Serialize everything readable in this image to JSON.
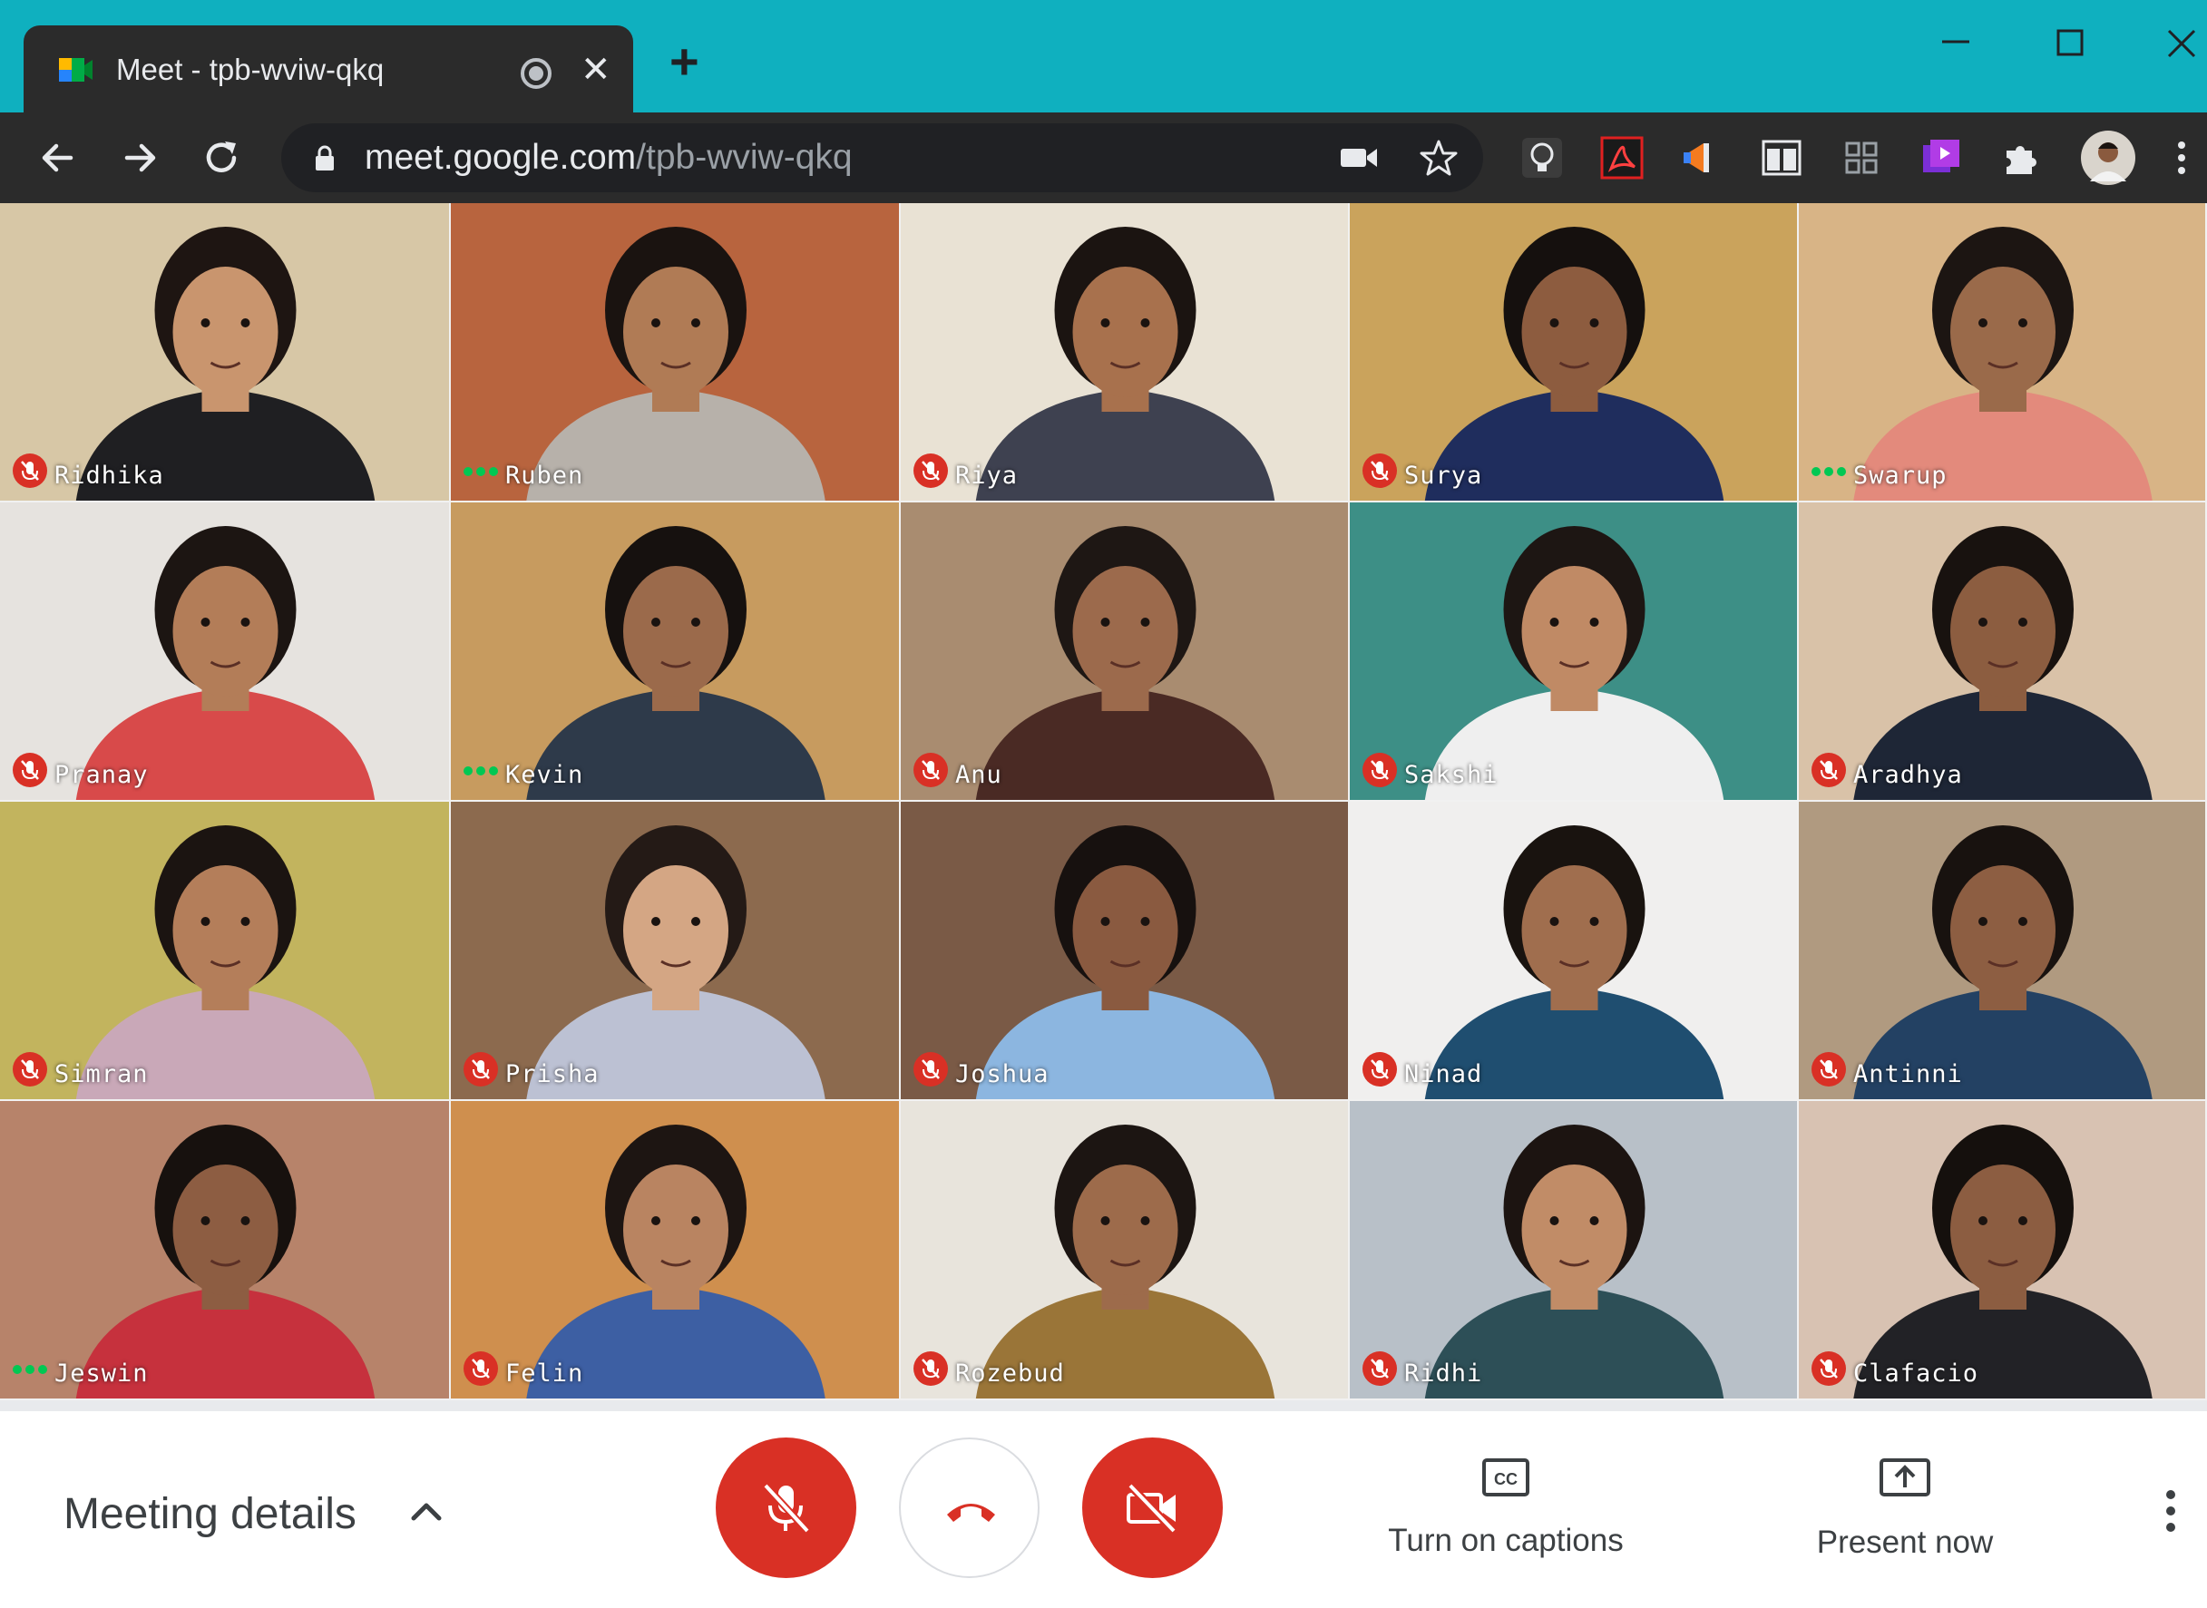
{
  "browser": {
    "tab_title": "Meet - tpb-wviw-qkq",
    "new_tab": "+",
    "close_tab": "✕",
    "url_host": "meet.google.com",
    "url_path": "/tpb-wviw-qkq",
    "colors": {
      "frame": "#0fb0bf",
      "toolbar": "#2b2b2b",
      "omnibox": "#202124"
    },
    "extensions": [
      "lightbulb-icon",
      "acrobat-icon",
      "megaphone-icon",
      "columns-icon",
      "grid-icon",
      "video-ext-icon",
      "puzzle-icon",
      "profile-avatar",
      "menu-dots-icon"
    ]
  },
  "participants": [
    {
      "name": "Ridhika",
      "status": "muted",
      "bg": "#d7c7a6",
      "skin": "#c9956e",
      "hair": "#1e1512",
      "shirt": "#1f1f22"
    },
    {
      "name": "Ruben",
      "status": "speaking",
      "bg": "#b8643e",
      "skin": "#b07b55",
      "hair": "#1a1310",
      "shirt": "#b7b1aa"
    },
    {
      "name": "Riya",
      "status": "muted",
      "bg": "#e9e2d4",
      "skin": "#a8714d",
      "hair": "#1b1411",
      "shirt": "#3e4150"
    },
    {
      "name": "Surya",
      "status": "muted",
      "bg": "#caa35c",
      "skin": "#8d5c3f",
      "hair": "#15100e",
      "shirt": "#1f2d5d"
    },
    {
      "name": "Swarup",
      "status": "speaking",
      "bg": "#d8b486",
      "skin": "#9a6a4a",
      "hair": "#1c1512",
      "shirt": "#e38a7c"
    },
    {
      "name": "Pranay",
      "status": "muted",
      "bg": "#e6e3df",
      "skin": "#b37d58",
      "hair": "#1c1512",
      "shirt": "#d84a4a"
    },
    {
      "name": "Kevin",
      "status": "speaking",
      "bg": "#c79b5f",
      "skin": "#9b6a4b",
      "hair": "#16110f",
      "shirt": "#2e3a4a"
    },
    {
      "name": "Anu",
      "status": "muted",
      "bg": "#a98c70",
      "skin": "#9c6a4c",
      "hair": "#1e1714",
      "shirt": "#4a2a24"
    },
    {
      "name": "Sakshi",
      "status": "muted",
      "bg": "#3d8f86",
      "skin": "#c08a65",
      "hair": "#1d1613",
      "shirt": "#efefef"
    },
    {
      "name": "Aradhya",
      "status": "muted",
      "bg": "#d9c2a8",
      "skin": "#8c5d40",
      "hair": "#18120f",
      "shirt": "#1e2636"
    },
    {
      "name": "Simran",
      "status": "muted",
      "bg": "#c2b45e",
      "skin": "#b47e5a",
      "hair": "#1b1411",
      "shirt": "#c9a8b8"
    },
    {
      "name": "Prisha",
      "status": "muted",
      "bg": "#8c6a4e",
      "skin": "#d4a684",
      "hair": "#241a16",
      "shirt": "#bcc1d3"
    },
    {
      "name": "Joshua",
      "status": "muted",
      "bg": "#7a5a46",
      "skin": "#8a5a40",
      "hair": "#17110f",
      "shirt": "#8cb6e0"
    },
    {
      "name": "Ninad",
      "status": "muted",
      "bg": "#f0efee",
      "skin": "#a06e4e",
      "hair": "#19130f",
      "shirt": "#1f4e70"
    },
    {
      "name": "Antinni",
      "status": "muted",
      "bg": "#b09a80",
      "skin": "#8d5e42",
      "hair": "#18120f",
      "shirt": "#234163"
    },
    {
      "name": "Jeswin",
      "status": "speaking",
      "bg": "#b7836a",
      "skin": "#8d5d42",
      "hair": "#17110e",
      "shirt": "#c6313d"
    },
    {
      "name": "Felin",
      "status": "muted",
      "bg": "#cf8f4e",
      "skin": "#b98461",
      "hair": "#1d1512",
      "shirt": "#3d5fa3"
    },
    {
      "name": "Rozebud",
      "status": "muted",
      "bg": "#e8e4dc",
      "skin": "#9d6b4b",
      "hair": "#1c1512",
      "shirt": "#9a7538"
    },
    {
      "name": "Ridhi",
      "status": "muted",
      "bg": "#b8c0c8",
      "skin": "#c18c67",
      "hair": "#1c1411",
      "shirt": "#2d4f57"
    },
    {
      "name": "Clafacio",
      "status": "muted",
      "bg": "#d8c2b2",
      "skin": "#8c5d41",
      "hair": "#15100d",
      "shirt": "#222226"
    }
  ],
  "controls": {
    "meeting_details": "Meeting details",
    "captions_label": "Turn on captions",
    "present_label": "Present now",
    "colors": {
      "danger": "#d93025",
      "muted_badge": "#d93025",
      "speaking": "#00c853"
    }
  }
}
